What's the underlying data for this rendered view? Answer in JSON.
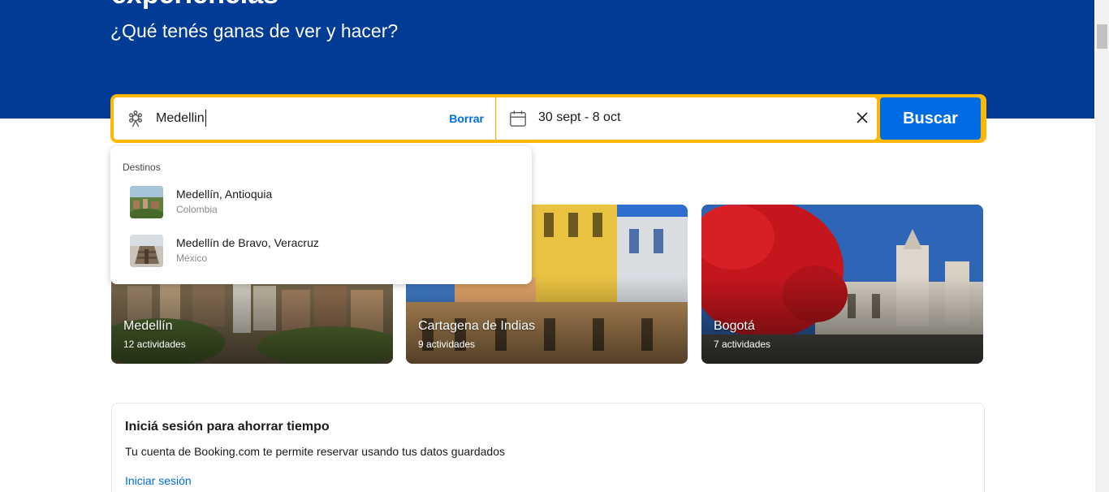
{
  "hero": {
    "title": "experiencias",
    "subtitle": "¿Qué tenés ganas de ver y hacer?"
  },
  "search": {
    "destination_value": "Medellin",
    "destination_icon": "attraction-icon",
    "clear_label": "Borrar",
    "date_icon": "calendar-icon",
    "dates": "30 sept - 8 oct",
    "clear_dates_icon": "close-icon",
    "button_label": "Buscar"
  },
  "dropdown": {
    "heading": "Destinos",
    "items": [
      {
        "title": "Medellín, Antioquia",
        "subtitle": "Colombia"
      },
      {
        "title": "Medellín de Bravo, Veracruz",
        "subtitle": "México"
      }
    ]
  },
  "cards": [
    {
      "name": "Medellín",
      "count": "12 actividades"
    },
    {
      "name": "Cartagena de Indias",
      "count": "9 actividades"
    },
    {
      "name": "Bogotá",
      "count": "7 actividades"
    }
  ],
  "signin": {
    "title": "Iniciá sesión para ahorrar tiempo",
    "text": "Tu cuenta de Booking.com te permite reservar usando tus datos guardados",
    "link": "Iniciar sesión"
  },
  "colors": {
    "brand_blue": "#003b95",
    "action_blue": "#006ce4",
    "search_border": "#ffb700"
  }
}
